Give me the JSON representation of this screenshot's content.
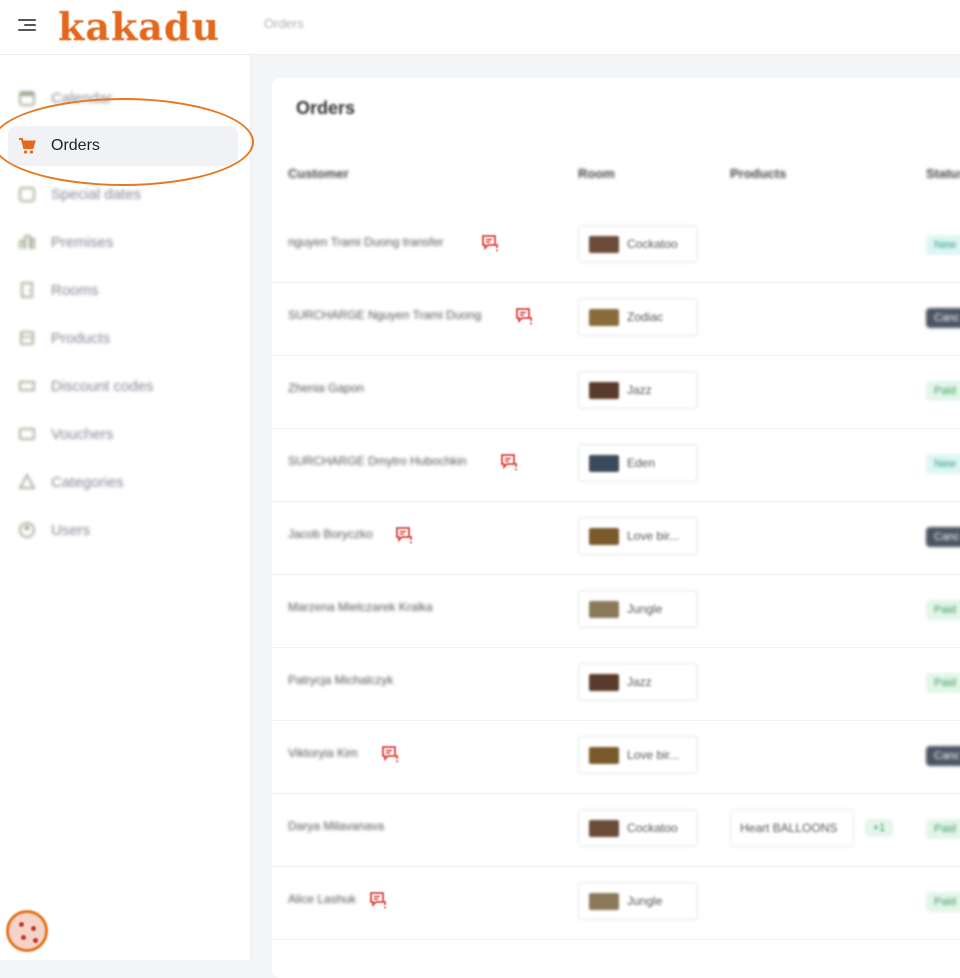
{
  "header": {
    "logo": "kakadu",
    "breadcrumb": "Orders"
  },
  "sidebar": {
    "items": [
      {
        "label": "Calendar",
        "icon": "calendar-icon"
      },
      {
        "label": "Orders",
        "icon": "cart-icon"
      },
      {
        "label": "Special dates",
        "icon": "calendar-star-icon"
      },
      {
        "label": "Premises",
        "icon": "building-icon"
      },
      {
        "label": "Rooms",
        "icon": "door-icon"
      },
      {
        "label": "Products",
        "icon": "box-icon"
      },
      {
        "label": "Discount codes",
        "icon": "ticket-icon"
      },
      {
        "label": "Vouchers",
        "icon": "voucher-icon"
      },
      {
        "label": "Categories",
        "icon": "shapes-icon"
      },
      {
        "label": "Users",
        "icon": "user-icon"
      }
    ],
    "active_item": "Orders"
  },
  "main": {
    "title": "Orders",
    "columns": [
      "Customer",
      "Room",
      "Products",
      "Status"
    ],
    "rows": [
      {
        "customer": "nguyen Trami Duong transfer",
        "note": true,
        "room": "Cockatoo",
        "product": "",
        "more": "",
        "status": "New"
      },
      {
        "customer": "SURCHARGE Nguyen Trami Duong",
        "note": true,
        "room": "Zodiac",
        "product": "",
        "more": "",
        "status": "Canc"
      },
      {
        "customer": "Zhenia Gapon",
        "note": false,
        "room": "Jazz",
        "product": "",
        "more": "",
        "status": "Paid"
      },
      {
        "customer": "SURCHARGE Dmytro Hubochkin",
        "note": true,
        "room": "Eden",
        "product": "",
        "more": "",
        "status": "New"
      },
      {
        "customer": "Jacob Boryczko",
        "note": true,
        "room": "Love bir...",
        "product": "",
        "more": "",
        "status": "Canc"
      },
      {
        "customer": "Marzena Mielczarek Kralka",
        "note": false,
        "room": "Jungle",
        "product": "",
        "more": "",
        "status": "Paid"
      },
      {
        "customer": "Patrycja Michalczyk",
        "note": false,
        "room": "Jazz",
        "product": "",
        "more": "",
        "status": "Paid"
      },
      {
        "customer": "Viktoryia Kim",
        "note": true,
        "room": "Love bir...",
        "product": "",
        "more": "",
        "status": "Canc"
      },
      {
        "customer": "Darya Milavanava",
        "note": false,
        "room": "Cockatoo",
        "product": "Heart BALLOONS",
        "more": "+1",
        "status": "Paid"
      },
      {
        "customer": "Alice Lashuk",
        "note": true,
        "room": "Jungle",
        "product": "",
        "more": "",
        "status": "Paid"
      }
    ]
  },
  "colors": {
    "brand": "#e4671c",
    "note_icon": "#e0433e",
    "status_new_bg": "#def6f3",
    "status_new_fg": "#2a9d8f",
    "status_paid_bg": "#e3f6e9",
    "status_paid_fg": "#3b9b5d",
    "status_cancel_bg": "#4b5563",
    "status_cancel_fg": "#ffffff"
  }
}
